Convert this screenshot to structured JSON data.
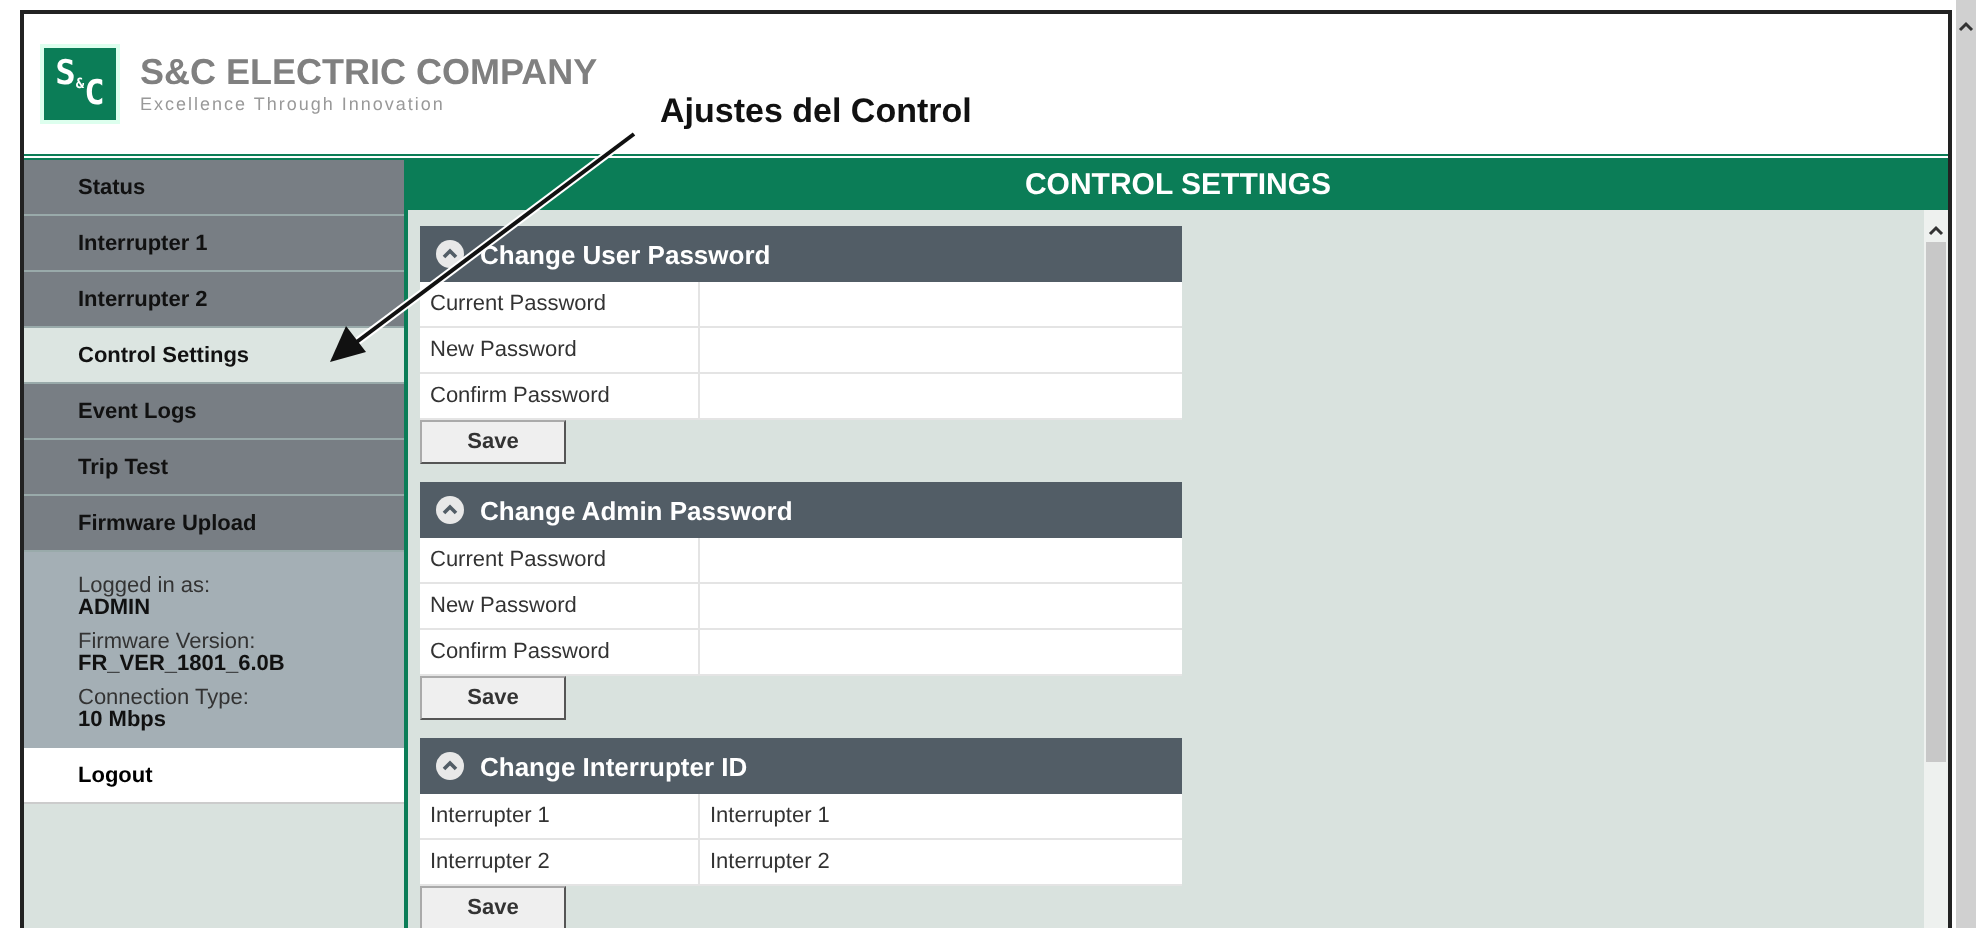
{
  "header": {
    "logo_letters": [
      "S",
      "&",
      "C"
    ],
    "company": "S&C ELECTRIC COMPANY",
    "tagline": "Excellence Through Innovation"
  },
  "annotation": {
    "text": "Ajustes del Control"
  },
  "sidebar": {
    "items": [
      {
        "label": "Status",
        "selected": false
      },
      {
        "label": "Interrupter 1",
        "selected": false
      },
      {
        "label": "Interrupter 2",
        "selected": false
      },
      {
        "label": "Control Settings",
        "selected": true
      },
      {
        "label": "Event Logs",
        "selected": false
      },
      {
        "label": "Trip Test",
        "selected": false
      },
      {
        "label": "Firmware Upload",
        "selected": false
      }
    ],
    "info": [
      {
        "label": "Logged in as:",
        "value": "ADMIN"
      },
      {
        "label": "Firmware Version:",
        "value": "FR_VER_1801_6.0B"
      },
      {
        "label": "Connection Type:",
        "value": "10 Mbps"
      }
    ],
    "logout": "Logout"
  },
  "page_title": "CONTROL SETTINGS",
  "sections": [
    {
      "title": "Change User Password",
      "expanded": true,
      "rows": [
        {
          "label": "Current Password"
        },
        {
          "label": "New Password"
        },
        {
          "label": "Confirm Password"
        }
      ],
      "button": "Save"
    },
    {
      "title": "Change Admin Password",
      "expanded": true,
      "rows": [
        {
          "label": "Current Password"
        },
        {
          "label": "New Password"
        },
        {
          "label": "Confirm Password"
        }
      ],
      "button": "Save"
    },
    {
      "title": "Change Interrupter ID",
      "expanded": true,
      "rows": [
        {
          "label": "Interrupter 1",
          "value": "Interrupter 1"
        },
        {
          "label": "Interrupter 2",
          "value": "Interrupter 2"
        }
      ],
      "button": "Save"
    }
  ]
}
